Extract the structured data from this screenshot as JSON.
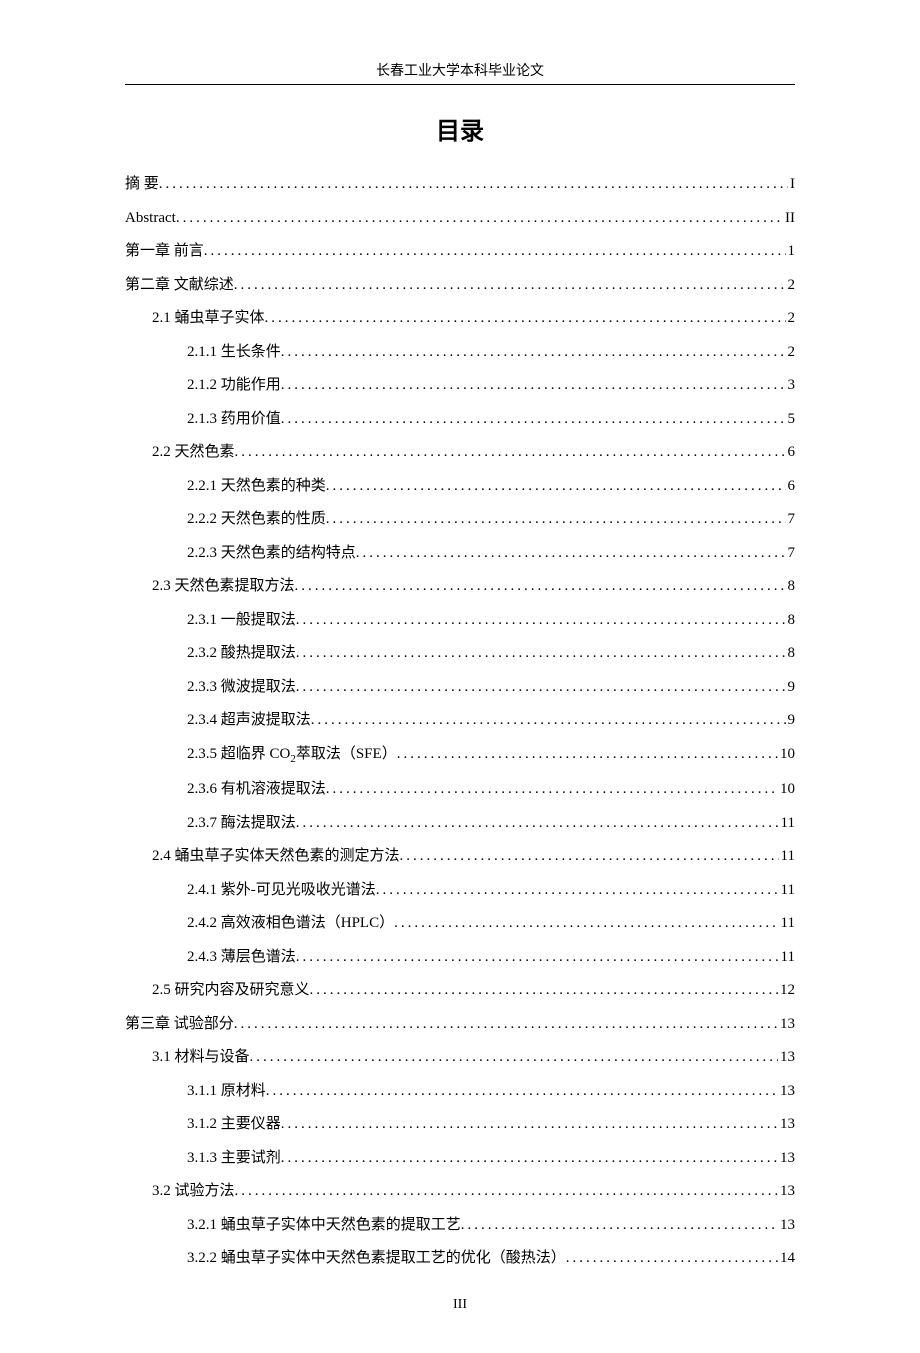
{
  "header": "长春工业大学本科毕业论文",
  "title": "目录",
  "footer": "III",
  "toc": [
    {
      "level": 0,
      "label": "摘  要",
      "page": "I"
    },
    {
      "level": 0,
      "label": "Abstract",
      "page": "II"
    },
    {
      "level": 0,
      "label": "第一章 前言",
      "page": "1"
    },
    {
      "level": 0,
      "label": "第二章 文献综述",
      "page": "2"
    },
    {
      "level": 1,
      "label": "2.1 蛹虫草子实体",
      "page": "2"
    },
    {
      "level": 2,
      "label": "2.1.1 生长条件",
      "page": "2"
    },
    {
      "level": 2,
      "label": "2.1.2 功能作用",
      "page": "3"
    },
    {
      "level": 2,
      "label": "2.1.3 药用价值",
      "page": "5"
    },
    {
      "level": 1,
      "label": "2.2 天然色素",
      "page": "6"
    },
    {
      "level": 2,
      "label": "2.2.1 天然色素的种类",
      "page": "6"
    },
    {
      "level": 2,
      "label": "2.2.2 天然色素的性质",
      "page": "7"
    },
    {
      "level": 2,
      "label": "2.2.3 天然色素的结构特点",
      "page": "7"
    },
    {
      "level": 1,
      "label": "2.3 天然色素提取方法",
      "page": "8"
    },
    {
      "level": 2,
      "label": "2.3.1 一般提取法",
      "page": "8"
    },
    {
      "level": 2,
      "label": "2.3.2 酸热提取法",
      "page": "8"
    },
    {
      "level": 2,
      "label": "2.3.3 微波提取法",
      "page": "9"
    },
    {
      "level": 2,
      "label": "2.3.4 超声波提取法",
      "page": "9"
    },
    {
      "level": 2,
      "label": "2.3.5 超临界 CO₂萃取法（SFE）",
      "page": "10"
    },
    {
      "level": 2,
      "label": "2.3.6 有机溶液提取法",
      "page": "10"
    },
    {
      "level": 2,
      "label": "2.3.7 酶法提取法",
      "page": "11"
    },
    {
      "level": 1,
      "label": "2.4 蛹虫草子实体天然色素的测定方法",
      "page": "11"
    },
    {
      "level": 2,
      "label": "2.4.1 紫外-可见光吸收光谱法",
      "page": "11"
    },
    {
      "level": 2,
      "label": "2.4.2 高效液相色谱法（HPLC）",
      "page": "11"
    },
    {
      "level": 2,
      "label": "2.4.3 薄层色谱法",
      "page": "11"
    },
    {
      "level": 1,
      "label": "2.5 研究内容及研究意义",
      "page": "12"
    },
    {
      "level": 0,
      "label": "第三章  试验部分",
      "page": "13"
    },
    {
      "level": 1,
      "label": "3.1 材料与设备",
      "page": "13"
    },
    {
      "level": 2,
      "label": "3.1.1 原材料",
      "page": "13"
    },
    {
      "level": 2,
      "label": "3.1.2 主要仪器",
      "page": "13"
    },
    {
      "level": 2,
      "label": "3.1.3 主要试剂",
      "page": "13"
    },
    {
      "level": 1,
      "label": "3.2 试验方法",
      "page": "13"
    },
    {
      "level": 2,
      "label": "3.2.1 蛹虫草子实体中天然色素的提取工艺",
      "page": "13"
    },
    {
      "level": 2,
      "label": "3.2.2 蛹虫草子实体中天然色素提取工艺的优化（酸热法）",
      "page": "14"
    }
  ]
}
